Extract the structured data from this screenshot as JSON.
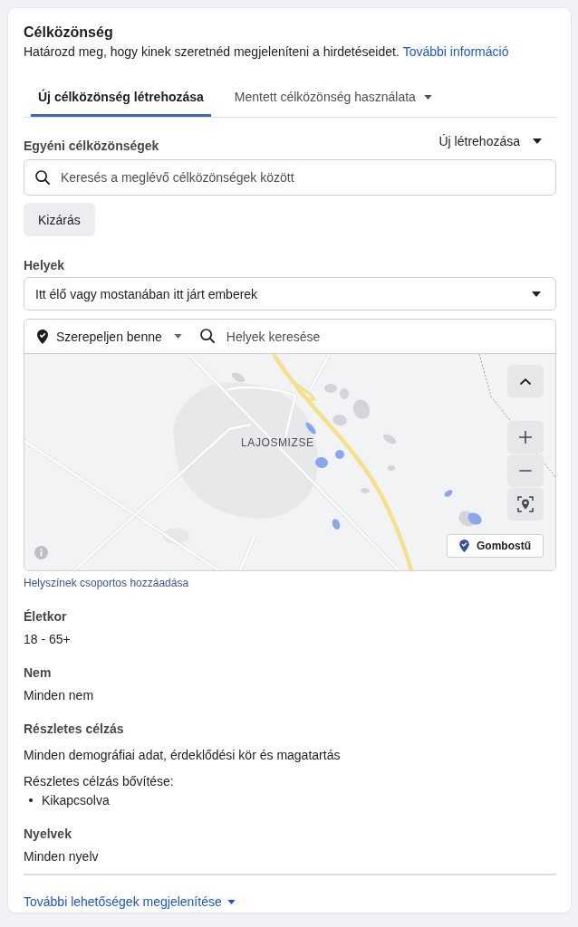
{
  "header": {
    "title": "Célközönség",
    "description": "Határozd meg, hogy kinek szeretnéd megjeleníteni a hirdetéseidet.",
    "link": "További információ"
  },
  "tabs": [
    {
      "label": "Új célközönség létrehozása",
      "selected": true,
      "dropdown": false
    },
    {
      "label": "Mentett célközönség használata",
      "selected": false,
      "dropdown": true
    }
  ],
  "custom_audiences": {
    "label": "Egyéni célközönségek",
    "create_button": "Új létrehozása",
    "search": {
      "placeholder": "Keresés a meglévő célközönségek között"
    },
    "exclude_button": "Kizárás"
  },
  "locations": {
    "label": "Helyek",
    "audience_type": "Itt élő vagy mostanában itt járt emberek",
    "include_dropdown": "Szerepeljen benne",
    "search": {
      "placeholder": "Helyek keresése"
    },
    "map": {
      "place_label": "LAJOSMIZSE",
      "pin_button": "Gombostű"
    },
    "bulk_add_link": "Helyszínek csoportos hozzáadása"
  },
  "summary": [
    {
      "label": "Életkor",
      "value": "18 - 65+"
    },
    {
      "label": "Nem",
      "value": "Minden nem"
    },
    {
      "label": "Részletes célzás",
      "value": "Minden demográfiai adat, érdeklődési kör és magatartás",
      "sub_label": "Részletes célzás bővítése:",
      "bullets": [
        "Kikapcsolva"
      ]
    },
    {
      "label": "Nyelvek",
      "value": "Minden nyelv"
    }
  ],
  "show_more_link": "További lehetőségek megjelenítése"
}
